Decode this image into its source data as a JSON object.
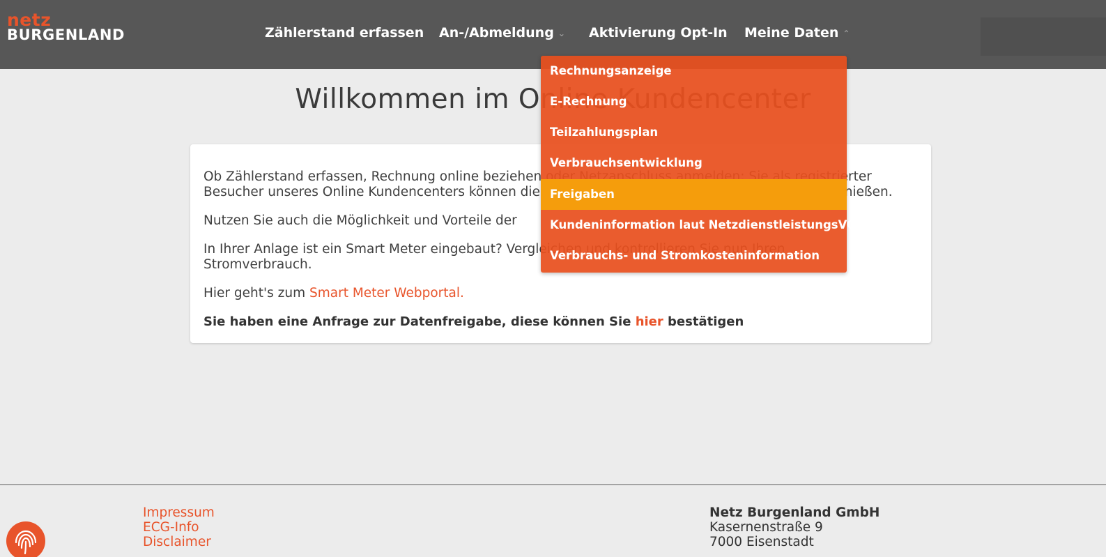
{
  "logo": {
    "line1": "netz",
    "line2": "BURGENLAND"
  },
  "nav": {
    "items": [
      {
        "label": "Zählerstand erfassen"
      },
      {
        "label": "An-/Abmeldung"
      },
      {
        "label": "Aktivierung Opt-In"
      },
      {
        "label": "Meine Daten"
      }
    ]
  },
  "dropdown": {
    "items": [
      {
        "label": "Rechnungsanzeige"
      },
      {
        "label": "E-Rechnung"
      },
      {
        "label": "Teilzahlungsplan"
      },
      {
        "label": "Verbrauchsentwicklung"
      },
      {
        "label": "Freigaben",
        "active": true
      },
      {
        "label": "Kundeninformation laut NetzdienstleistungsVO"
      },
      {
        "label": "Verbrauchs- und Stromkosteninformation"
      }
    ]
  },
  "main": {
    "title": "Willkommen im Online Kundencenter",
    "p1_line1": "Ob Zählerstand erfassen, Rechnung online beziehen oder Netzanschluss anmelden: Sie als registrierter",
    "p1_line2": "Besucher unseres Online Kundencenters können diese und weitere Vorteile ganz bequem online genießen.",
    "p2": "Nutzen Sie auch die Möglichkeit und Vorteile der",
    "p3_line1": "In Ihrer Anlage ist ein Smart Meter eingebaut? Vergleichen und kontrollieren Sie nun Ihren",
    "p3_line2": "Stromverbrauch.",
    "p4_prefix": "Hier geht's zum",
    "p4_link": "Smart Meter Webportal.",
    "p5_prefix": "Sie haben eine Anfrage zur Datenfreigabe, diese können Sie",
    "p5_link": "hier",
    "p5_suffix": "bestätigen"
  },
  "footer": {
    "links": [
      {
        "label": "Impressum"
      },
      {
        "label": "ECG-Info"
      },
      {
        "label": "Disclaimer"
      }
    ],
    "company": "Netz Burgenland GmbH",
    "street": "Kasernenstraße 9",
    "city": "7000 Eisenstadt"
  },
  "colors": {
    "accent": "#e8542b",
    "header_bg": "#575757",
    "dropdown_bg": "#e8501e",
    "dropdown_active": "#f59d0c",
    "page_bg": "#ececec"
  },
  "icons": {
    "nav_dropdown_closed": "chevron-down-icon",
    "nav_dropdown_open": "chevron-up-icon",
    "footer_badge": "fingerprint-icon"
  }
}
